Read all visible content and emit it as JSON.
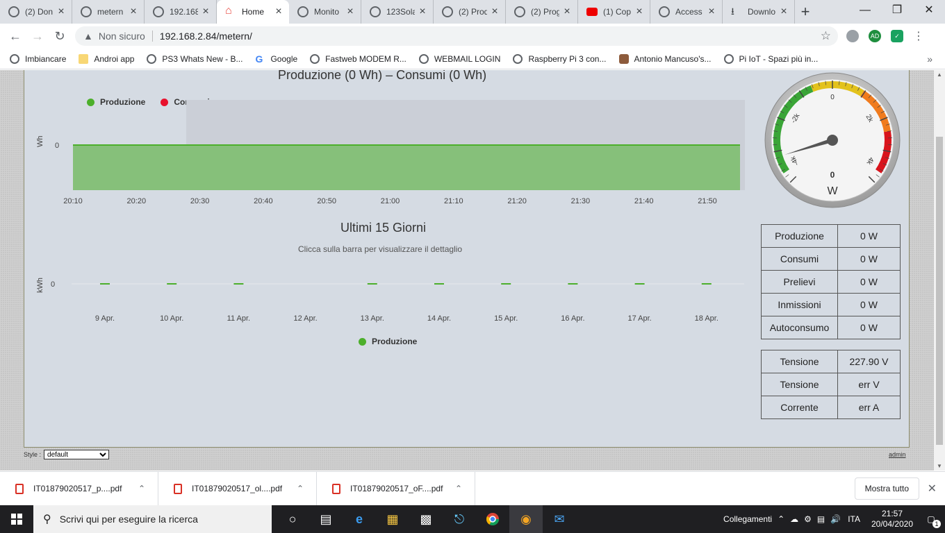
{
  "browser": {
    "tabs": [
      {
        "label": "(2) Don",
        "icon": "globe-icon",
        "active": false
      },
      {
        "label": "metern",
        "icon": "chart-icon",
        "active": false
      },
      {
        "label": "192.168",
        "icon": "globe-icon",
        "active": false
      },
      {
        "label": "Home",
        "icon": "home-icon",
        "active": true
      },
      {
        "label": "Monito",
        "icon": "globe-icon",
        "active": false
      },
      {
        "label": "123Sola",
        "icon": "globe-icon",
        "active": false
      },
      {
        "label": "(2) Prod",
        "icon": "globe-icon",
        "active": false
      },
      {
        "label": "(2) Prog",
        "icon": "globe-icon",
        "active": false
      },
      {
        "label": "(1) Cop",
        "icon": "youtube-icon",
        "active": false
      },
      {
        "label": "Access",
        "icon": "app-icon",
        "active": false
      },
      {
        "label": "Downlo",
        "icon": "download-icon",
        "active": false
      }
    ],
    "new_tab": "+",
    "security_label": "Non sicuro",
    "url": "192.168.2.84/metern/",
    "profile_badge": "AD",
    "bookmarks": [
      {
        "label": "Imbiancare",
        "icon": "globe-icon"
      },
      {
        "label": "Androi app",
        "icon": "folder-icon"
      },
      {
        "label": "PS3 Whats New - B...",
        "icon": "globe-icon"
      },
      {
        "label": "Google",
        "icon": "google-icon"
      },
      {
        "label": "Fastweb MODEM R...",
        "icon": "globe-icon"
      },
      {
        "label": "WEBMAIL LOGIN",
        "icon": "globe-icon"
      },
      {
        "label": "Raspberry Pi 3 con...",
        "icon": "globe-icon"
      },
      {
        "label": "Antonio Mancuso's...",
        "icon": "avatar-icon"
      },
      {
        "label": "Pi IoT - Spazi più in...",
        "icon": "globe-icon"
      }
    ],
    "bookmarks_more": "»"
  },
  "page": {
    "chart1": {
      "title": "Produzione (0 Wh) – Consumi (0 Wh)",
      "ylabel": "Wh",
      "legend": [
        {
          "name": "Produzione",
          "color": "#4caf2b"
        },
        {
          "name": "Consumi",
          "color": "#e8112d"
        }
      ]
    },
    "chart2": {
      "title": "Ultimi 15 Giorni",
      "subtitle": "Clicca sulla barra per visualizzare il dettaglio",
      "ylabel": "kWh",
      "legend": [
        {
          "name": "Produzione",
          "color": "#4caf2b"
        }
      ]
    },
    "gauge": {
      "value": 0,
      "unit": "W",
      "ticks": [
        "-4k",
        "-2k",
        "0",
        "2k",
        "4k"
      ]
    },
    "stats": [
      {
        "label": "Produzione",
        "value": "0 W"
      },
      {
        "label": "Consumi",
        "value": "0 W"
      },
      {
        "label": "Prelievi",
        "value": "0 W"
      },
      {
        "label": "Inmissioni",
        "value": "0 W"
      },
      {
        "label": "Autoconsumo",
        "value": "0 W"
      }
    ],
    "electrical": [
      {
        "label": "Tensione",
        "value": "227.90 V"
      },
      {
        "label": "Tensione",
        "value": "err V"
      },
      {
        "label": "Corrente",
        "value": "err A"
      }
    ],
    "style_label": "Style :",
    "style_value": "default",
    "admin_link": "admin"
  },
  "chart_data": [
    {
      "type": "area",
      "title": "Produzione (0 Wh) – Consumi (0 Wh)",
      "ylabel": "Wh",
      "x": [
        "20:10",
        "20:20",
        "20:30",
        "20:40",
        "20:50",
        "21:00",
        "21:10",
        "21:20",
        "21:30",
        "21:40",
        "21:50"
      ],
      "series": [
        {
          "name": "Produzione",
          "color": "#4caf2b",
          "values": [
            0,
            0,
            0,
            0,
            0,
            0,
            0,
            0,
            0,
            0,
            0
          ]
        },
        {
          "name": "Consumi",
          "color": "#e8112d",
          "values": [
            0,
            0,
            0,
            0,
            0,
            0,
            0,
            0,
            0,
            0,
            0
          ]
        }
      ],
      "yticks": [
        "0"
      ],
      "legend": "top-left"
    },
    {
      "type": "bar",
      "title": "Ultimi 15 Giorni",
      "subtitle": "Clicca sulla barra per visualizzare il dettaglio",
      "ylabel": "kWh",
      "categories": [
        "9 Apr.",
        "10 Apr.",
        "11 Apr.",
        "12 Apr.",
        "13 Apr.",
        "14 Apr.",
        "15 Apr.",
        "16 Apr.",
        "17 Apr.",
        "18 Apr."
      ],
      "series": [
        {
          "name": "Produzione",
          "color": "#4caf2b",
          "values": [
            0,
            0,
            0,
            null,
            0,
            0,
            0,
            0,
            0,
            0
          ]
        }
      ],
      "yticks": [
        "0"
      ],
      "legend": "bottom-center"
    }
  ],
  "downloads": {
    "items": [
      {
        "label": "IT01879020517_p....pdf"
      },
      {
        "label": "IT01879020517_ol....pdf"
      },
      {
        "label": "IT01879020517_oF....pdf"
      }
    ],
    "show_all": "Mostra tutto"
  },
  "taskbar": {
    "search_placeholder": "Scrivi qui per eseguire la ricerca",
    "tray_label": "Collegamenti",
    "language": "ITA",
    "time": "21:57",
    "date": "20/04/2020",
    "notification_count": "1"
  }
}
